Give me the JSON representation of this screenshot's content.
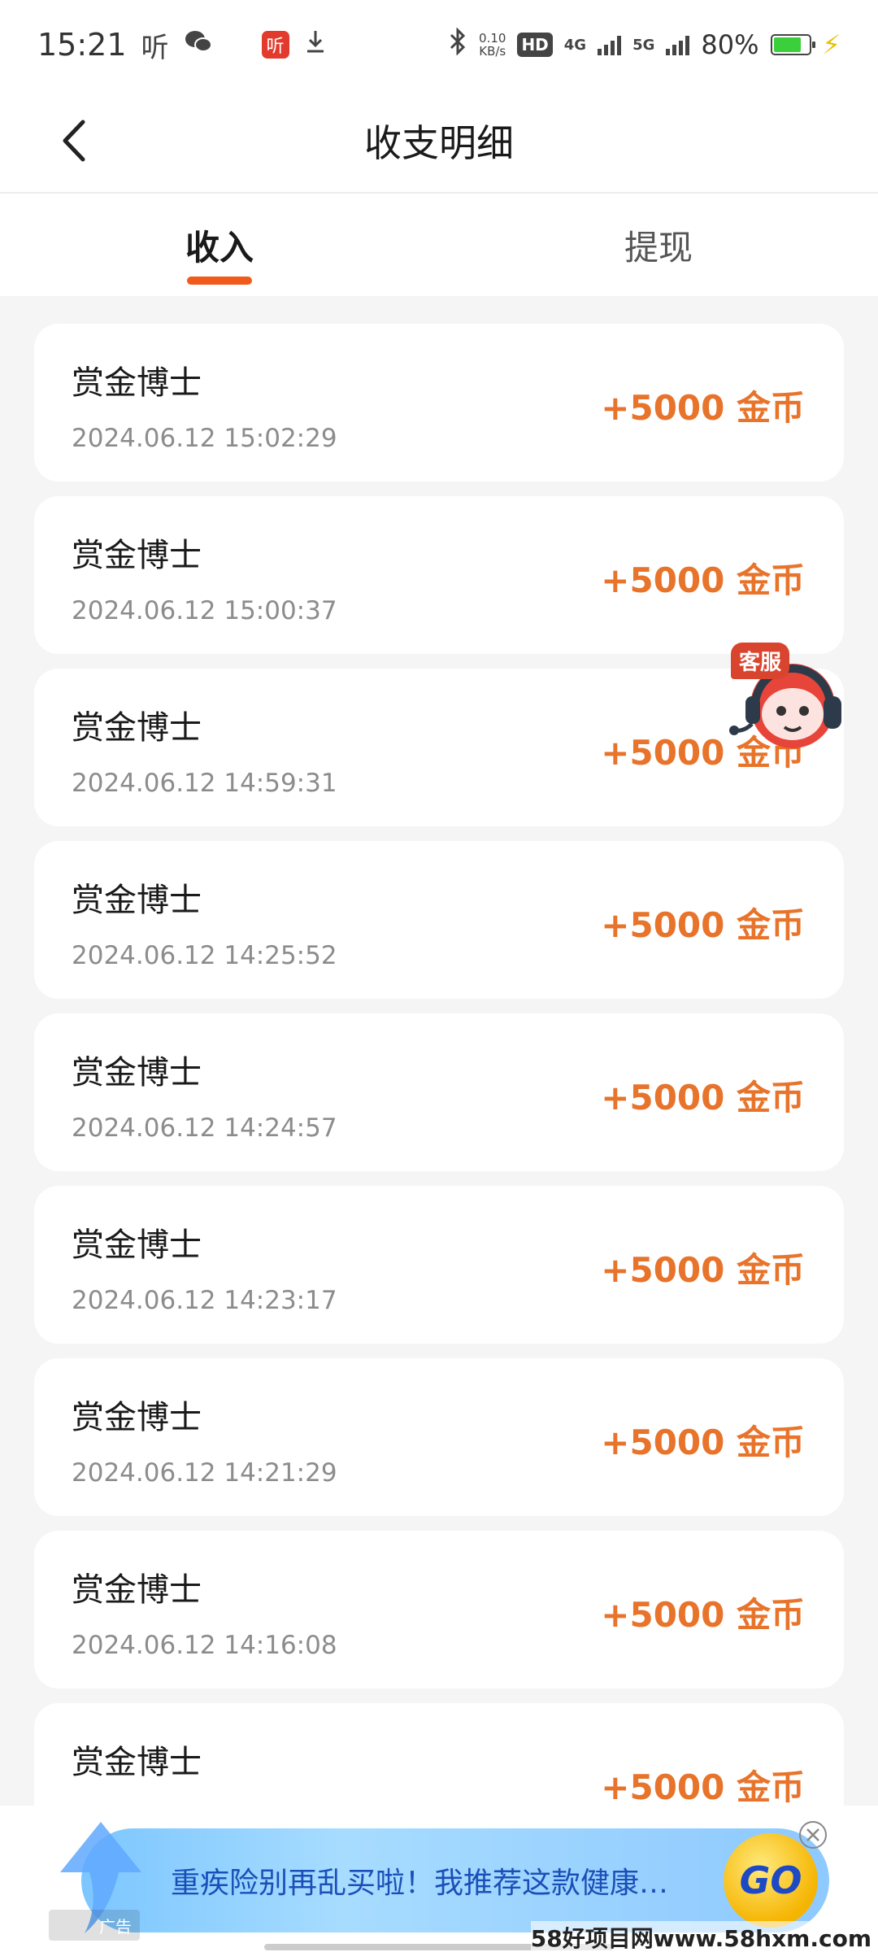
{
  "status_bar": {
    "time": "15:21",
    "listen_label": "听",
    "badge_label": "听",
    "speed_value": "0.10",
    "speed_unit": "KB/s",
    "hd_label": "HD",
    "net1": "4G",
    "net2": "5G",
    "battery": "80%"
  },
  "header": {
    "title": "收支明细"
  },
  "tabs": [
    {
      "label": "收入",
      "active": true
    },
    {
      "label": "提现",
      "active": false
    }
  ],
  "records": [
    {
      "name": "赏金博士",
      "time": "2024.06.12 15:02:29",
      "amount": "+5000 金币"
    },
    {
      "name": "赏金博士",
      "time": "2024.06.12 15:00:37",
      "amount": "+5000 金币"
    },
    {
      "name": "赏金博士",
      "time": "2024.06.12 14:59:31",
      "amount": "+5000 金币"
    },
    {
      "name": "赏金博士",
      "time": "2024.06.12 14:25:52",
      "amount": "+5000 金币"
    },
    {
      "name": "赏金博士",
      "time": "2024.06.12 14:24:57",
      "amount": "+5000 金币"
    },
    {
      "name": "赏金博士",
      "time": "2024.06.12 14:23:17",
      "amount": "+5000 金币"
    },
    {
      "name": "赏金博士",
      "time": "2024.06.12 14:21:29",
      "amount": "+5000 金币"
    },
    {
      "name": "赏金博士",
      "time": "2024.06.12 14:16:08",
      "amount": "+5000 金币"
    },
    {
      "name": "赏金博士",
      "time": "",
      "amount": "+5000 金币"
    }
  ],
  "customer_service": {
    "label": "客服"
  },
  "ad": {
    "text": "重疾险别再乱买啦！我推荐这款健康…",
    "go_label": "GO",
    "tag": "广告"
  },
  "watermark": "58好项目网www.58hxm.com",
  "colors": {
    "accent": "#f05a1a",
    "amount": "#e8732a",
    "background": "#f5f5f5"
  }
}
